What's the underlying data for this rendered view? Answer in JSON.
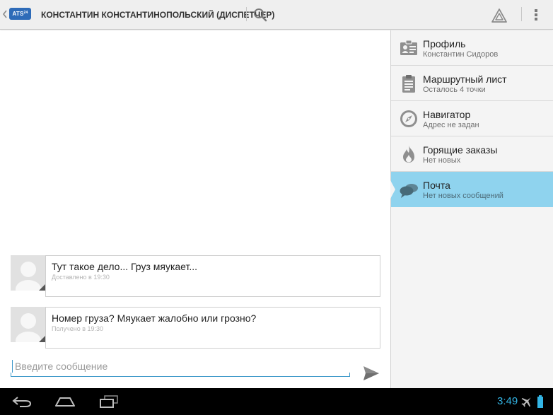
{
  "app": {
    "logo_text": "ATS",
    "logo_sup": "24",
    "title": "КОНСТАНТИН КОНСТАНТИНОПОЛЬСКИЙ (ДИСПЕТЧЕР)"
  },
  "actionbar": {
    "icons": [
      "up-caret-icon",
      "search-icon",
      "warning-icon",
      "overflow-menu-icon"
    ]
  },
  "messages": [
    {
      "text": "Тут такое дело... Груз мяукает...",
      "status": "Доставлено в 19:30"
    },
    {
      "text": "Номер груза? Мяукает жалобно или грозно?",
      "status": "Получено в 19:30"
    }
  ],
  "composer": {
    "placeholder": "Введите сообщение",
    "value": ""
  },
  "sidebar": {
    "items": [
      {
        "label": "Профиль",
        "sub": "Константин Сидоров",
        "icon": "profile-card-icon",
        "active": false
      },
      {
        "label": "Маршрутный лист",
        "sub": "Осталось 4 точки",
        "icon": "clipboard-icon",
        "active": false
      },
      {
        "label": "Навигатор",
        "sub": "Адрес не задан",
        "icon": "compass-icon",
        "active": false
      },
      {
        "label": "Горящие заказы",
        "sub": "Нет новых",
        "icon": "fire-icon",
        "active": false
      },
      {
        "label": "Почта",
        "sub": "Нет новых сообщений",
        "icon": "chat-bubbles-icon",
        "active": true
      }
    ]
  },
  "system": {
    "clock": "3:49",
    "accent": "#33b5e5"
  },
  "colors": {
    "active_item": "#8fd3ee",
    "input_underline": "#3b97c9",
    "logo": "#2e6bb8"
  }
}
